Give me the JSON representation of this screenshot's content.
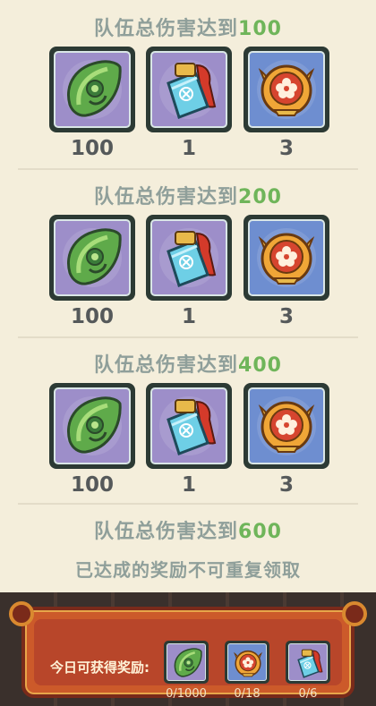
{
  "tiers": [
    {
      "title_prefix": "队伍总伤害达到",
      "threshold": "100",
      "rewards": [
        {
          "icon": "jade-leaf-icon",
          "qty": "100"
        },
        {
          "icon": "ice-scroll-icon",
          "qty": "1"
        },
        {
          "icon": "flower-medallion-icon",
          "qty": "3"
        }
      ]
    },
    {
      "title_prefix": "队伍总伤害达到",
      "threshold": "200",
      "rewards": [
        {
          "icon": "jade-leaf-icon",
          "qty": "100"
        },
        {
          "icon": "ice-scroll-icon",
          "qty": "1"
        },
        {
          "icon": "flower-medallion-icon",
          "qty": "3"
        }
      ]
    },
    {
      "title_prefix": "队伍总伤害达到",
      "threshold": "400",
      "rewards": [
        {
          "icon": "jade-leaf-icon",
          "qty": "100"
        },
        {
          "icon": "ice-scroll-icon",
          "qty": "1"
        },
        {
          "icon": "flower-medallion-icon",
          "qty": "3"
        }
      ]
    },
    {
      "title_prefix": "队伍总伤害达到",
      "threshold": "600"
    }
  ],
  "notice": "已达成的奖励不可重复领取",
  "daily": {
    "label": "今日可获得奖励:",
    "items": [
      {
        "icon": "jade-leaf-icon",
        "count": "0/1000"
      },
      {
        "icon": "flower-medallion-icon",
        "count": "0/18"
      },
      {
        "icon": "ice-scroll-icon",
        "count": "0/6"
      }
    ]
  },
  "colors": {
    "threshold": "#6fb55a",
    "title": "#8f9f9a",
    "panel": "#f4eedb",
    "banner": "#cc5a2a"
  }
}
